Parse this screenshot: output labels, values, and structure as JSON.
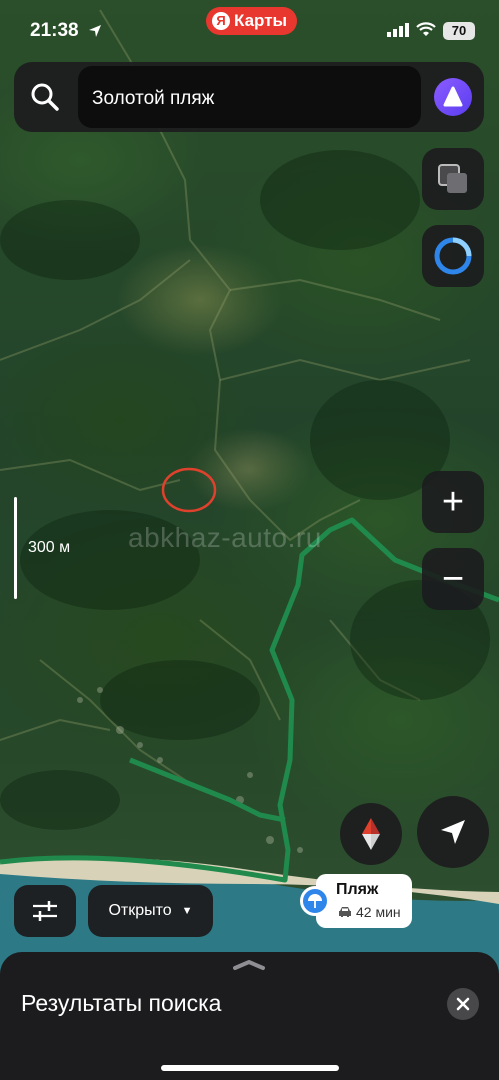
{
  "status_bar": {
    "time": "21:38",
    "app_name": "Карты",
    "app_logo_letter": "Я",
    "battery": "70"
  },
  "search": {
    "query": "Золотой пляж"
  },
  "map": {
    "watermark": "abkhaz-auto.ru",
    "scale_label": "300 м",
    "route_color": "#1f8a4c",
    "marker_color": "#e0412c"
  },
  "controls": {
    "zoom_in": "+",
    "zoom_out": "−"
  },
  "filters": {
    "open_label": "Открыто",
    "open_caret": "▼"
  },
  "pin": {
    "title": "Пляж",
    "eta": "42 мин"
  },
  "sheet": {
    "title": "Результаты поиска"
  },
  "colors": {
    "accent": "#8b5cff",
    "pin_blue": "#2f86ea",
    "app_red": "#e8372e"
  }
}
